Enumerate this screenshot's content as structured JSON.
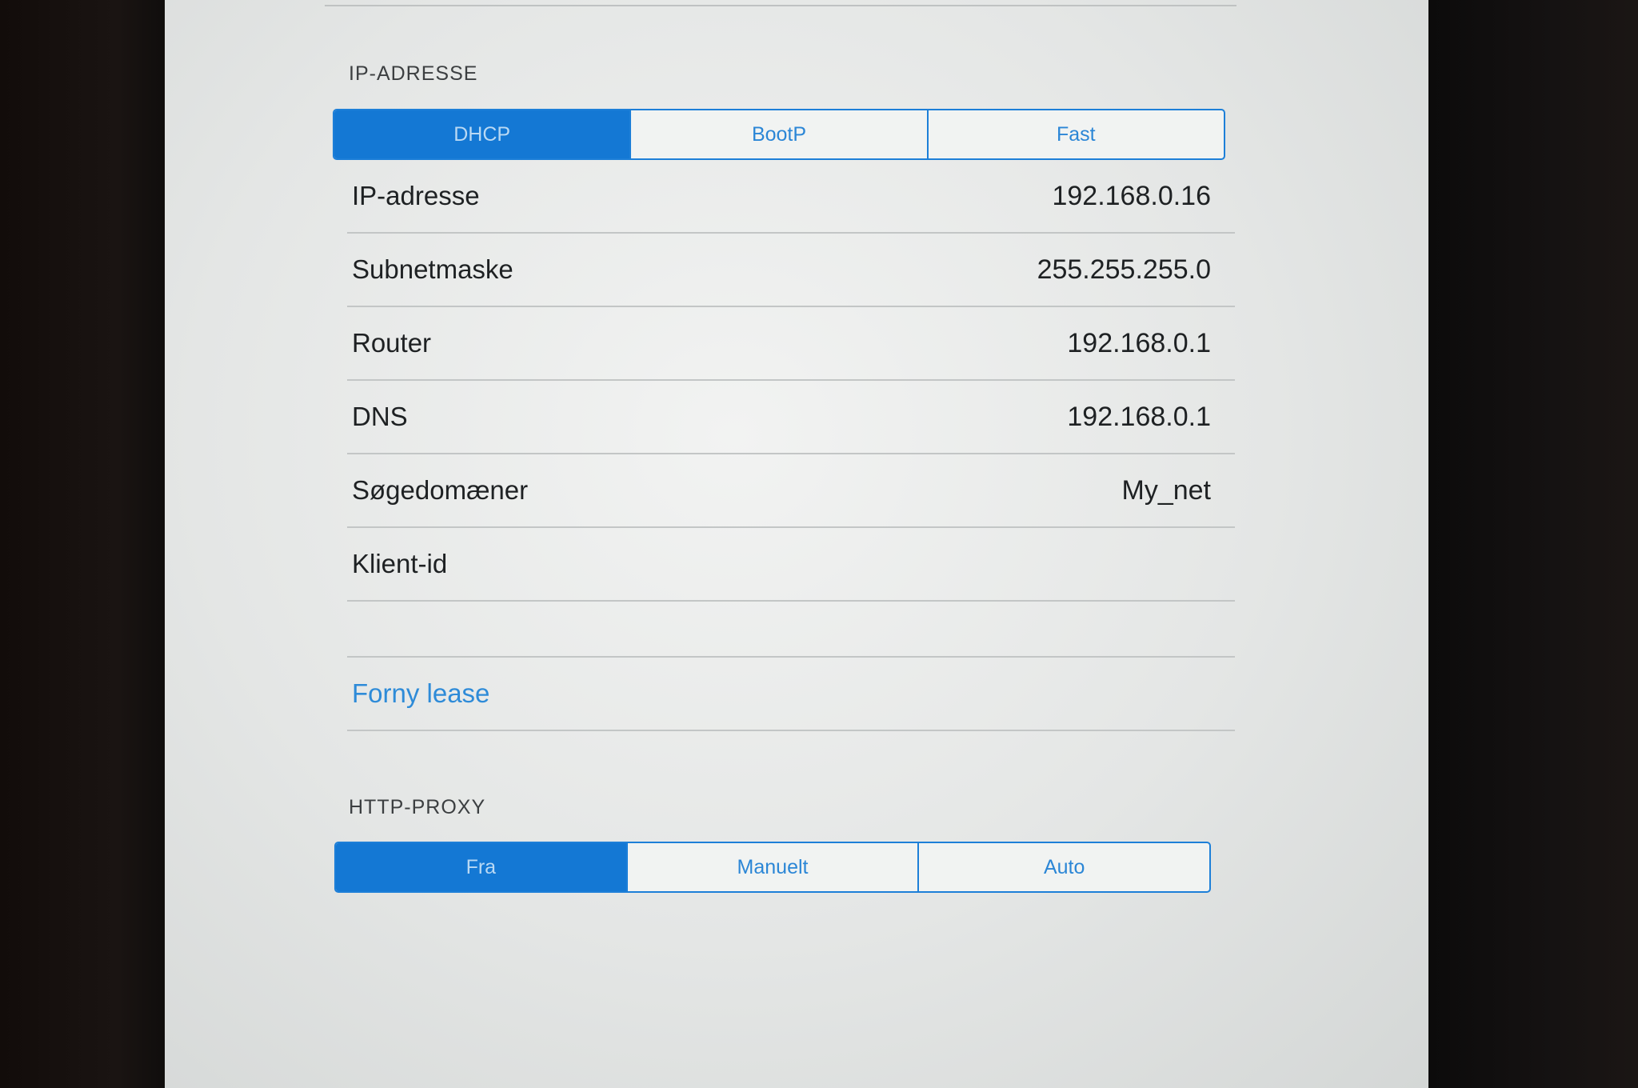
{
  "ip_section": {
    "header": "IP-ADRESSE",
    "segments": [
      {
        "label": "DHCP",
        "selected": true
      },
      {
        "label": "BootP",
        "selected": false
      },
      {
        "label": "Fast",
        "selected": false
      }
    ],
    "rows": [
      {
        "label": "IP-adresse",
        "value": "192.168.0.16"
      },
      {
        "label": "Subnetmaske",
        "value": "255.255.255.0"
      },
      {
        "label": "Router",
        "value": "192.168.0.1"
      },
      {
        "label": "DNS",
        "value": "192.168.0.1"
      },
      {
        "label": "Søgedomæner",
        "value": "My_net"
      },
      {
        "label": "Klient-id",
        "value": ""
      }
    ],
    "renew_lease": "Forny lease"
  },
  "proxy_section": {
    "header": "HTTP-PROXY",
    "segments": [
      {
        "label": "Fra",
        "selected": true
      },
      {
        "label": "Manuelt",
        "selected": false
      },
      {
        "label": "Auto",
        "selected": false
      }
    ]
  },
  "colors": {
    "accent": "#1478d4",
    "link": "#2e8bd8",
    "background": "#e9ebea"
  }
}
